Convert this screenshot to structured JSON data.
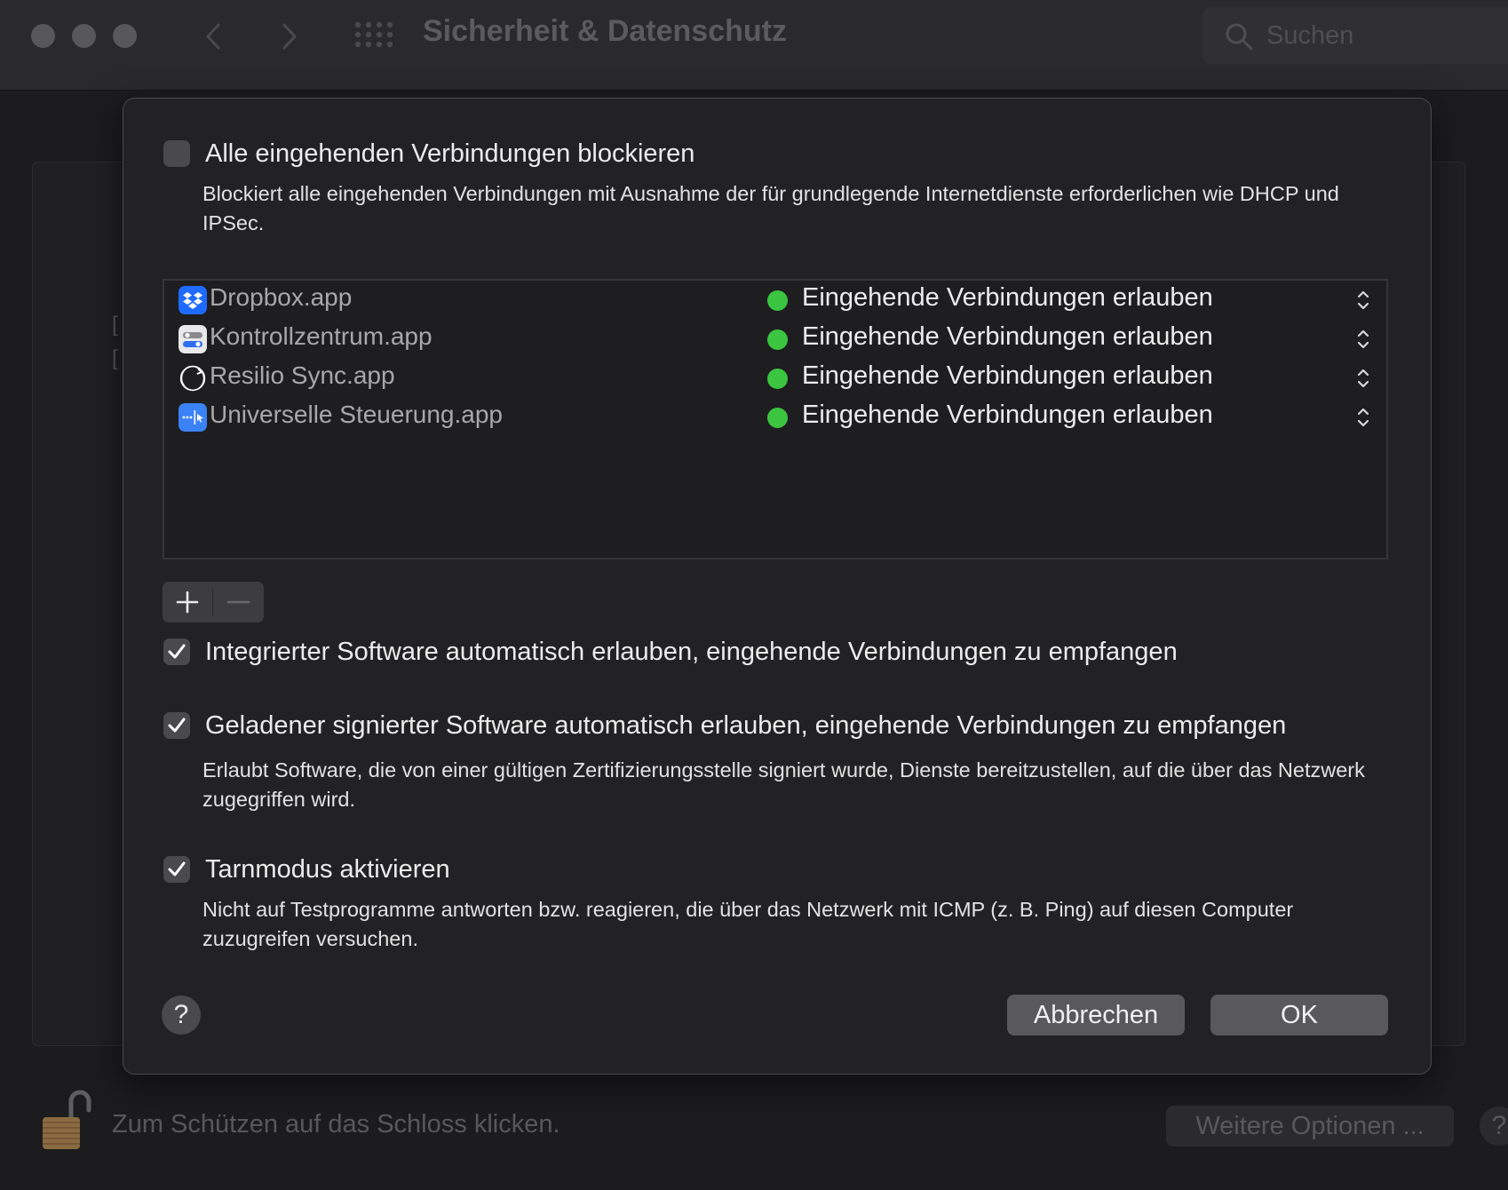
{
  "window": {
    "title": "Sicherheit & Datenschutz",
    "search_placeholder": "Suchen"
  },
  "firewall_options": {
    "block_all": {
      "label": "Alle eingehenden Verbindungen blockieren",
      "checked": false,
      "description": "Blockiert alle eingehenden Verbindungen mit Ausnahme der für grundlegende Internetdienste erforderlichen wie DHCP und IPSec."
    },
    "apps": [
      {
        "name": "Dropbox.app",
        "icon": "dropbox-icon",
        "status": "Eingehende Verbindungen erlauben"
      },
      {
        "name": "Kontrollzentrum.app",
        "icon": "control-center-icon",
        "status": "Eingehende Verbindungen erlauben"
      },
      {
        "name": "Resilio Sync.app",
        "icon": "resilio-sync-icon",
        "status": "Eingehende Verbindungen erlauben"
      },
      {
        "name": "Universelle Steuerung.app",
        "icon": "universal-control-icon",
        "status": "Eingehende Verbindungen erlauben"
      }
    ],
    "builtin_software": {
      "label": "Integrierter Software automatisch erlauben, eingehende Verbindungen zu empfangen",
      "checked": true
    },
    "signed_software": {
      "label": "Geladener signierter Software automatisch erlauben, eingehende Verbindungen zu empfangen",
      "checked": true,
      "description": "Erlaubt Software, die von einer gültigen Zertifizierungsstelle signiert wurde, Dienste bereitzustellen, auf die über das Netzwerk zugegriffen wird."
    },
    "stealth_mode": {
      "label": "Tarnmodus aktivieren",
      "checked": true,
      "description": "Nicht auf Testprogramme antworten bzw. reagieren, die über das Netzwerk mit ICMP (z. B. Ping) auf diesen Computer zuzugreifen versuchen."
    },
    "buttons": {
      "help": "?",
      "cancel": "Abbrechen",
      "ok": "OK"
    }
  },
  "footer": {
    "lock_text": "Zum Schützen auf das Schloss klicken.",
    "more_options": "Weitere Optionen ...",
    "help": "?"
  },
  "colors": {
    "status_dot": "#3bc541",
    "background": "#1c1c1e",
    "sheet": "#222224"
  }
}
